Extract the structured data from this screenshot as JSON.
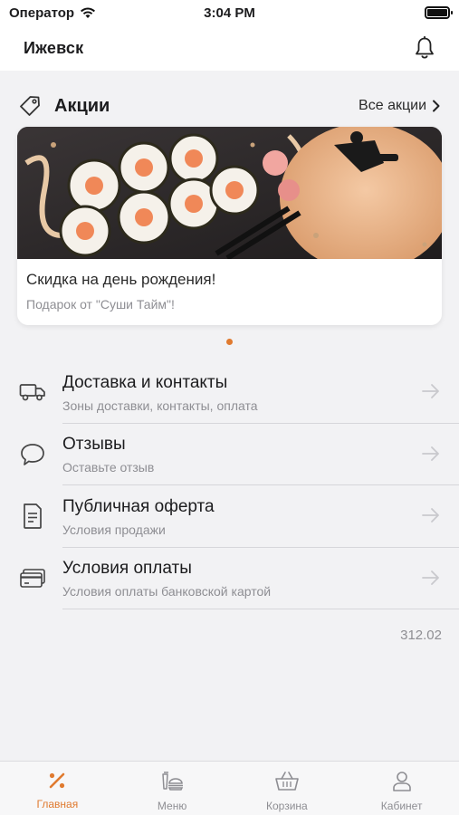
{
  "status_bar": {
    "carrier": "Оператор",
    "time": "3:04 PM"
  },
  "header": {
    "city": "Ижевск"
  },
  "promotions": {
    "title": "Акции",
    "all_link": "Все акции",
    "card": {
      "title": "Скидка на день рождения!",
      "subtitle": "Подарок от \"Суши Тайм\"!"
    }
  },
  "menu": {
    "items": [
      {
        "title": "Доставка и контакты",
        "subtitle": "Зоны доставки, контакты, оплата",
        "icon": "truck-icon"
      },
      {
        "title": "Отзывы",
        "subtitle": "Оставьте отзыв",
        "icon": "speech-bubble-icon"
      },
      {
        "title": "Публичная оферта",
        "subtitle": "Условия продажи",
        "icon": "document-icon"
      },
      {
        "title": "Условия оплаты",
        "subtitle": "Условия оплаты банковской картой",
        "icon": "credit-card-icon"
      }
    ]
  },
  "version": "312.02",
  "tab_bar": {
    "tabs": [
      {
        "label": "Главная",
        "icon": "percent-icon",
        "active": true
      },
      {
        "label": "Меню",
        "icon": "food-tray-icon",
        "active": false
      },
      {
        "label": "Корзина",
        "icon": "basket-icon",
        "active": false
      },
      {
        "label": "Кабинет",
        "icon": "person-icon",
        "active": false
      }
    ]
  },
  "colors": {
    "accent": "#e07a2f",
    "background": "#f2f2f4",
    "muted": "#8e8e93"
  }
}
